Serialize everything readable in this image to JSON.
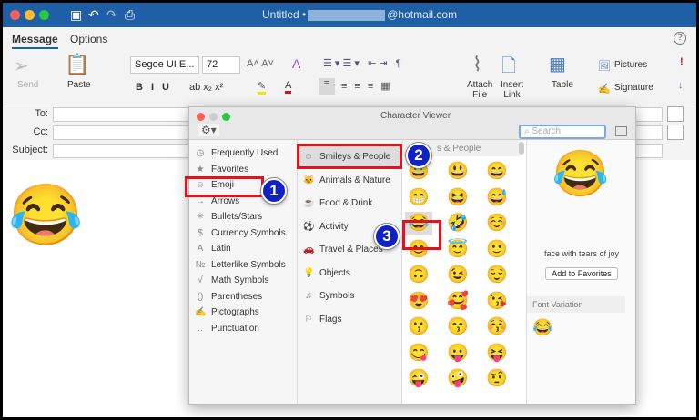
{
  "window": {
    "title_prefix": "Untitled •",
    "title_suffix": "@hotmail.com"
  },
  "tabs": [
    {
      "label": "Message",
      "active": true
    },
    {
      "label": "Options",
      "active": false
    }
  ],
  "ribbon": {
    "send": "Send",
    "paste": "Paste",
    "font": "Segoe UI E...",
    "size": "72",
    "attach": "Attach\nFile",
    "attach1": "Attach",
    "attach2": "File",
    "link1": "Insert",
    "link2": "Link",
    "table": "Table",
    "pictures": "Pictures",
    "signature": "Signature"
  },
  "fields": {
    "to": "To:",
    "cc": "Cc:",
    "subject": "Subject:"
  },
  "body_emoji": "😂",
  "char_viewer": {
    "title": "Character Viewer",
    "search_placeholder": "Search",
    "categories": [
      {
        "label": "Frequently Used",
        "icon": "◷"
      },
      {
        "label": "Favorites",
        "icon": "★"
      },
      {
        "label": "Emoji",
        "icon": "☺"
      },
      {
        "label": "Arrows",
        "icon": "→"
      },
      {
        "label": "Bullets/Stars",
        "icon": "✳"
      },
      {
        "label": "Currency Symbols",
        "icon": "$"
      },
      {
        "label": "Latin",
        "icon": "A"
      },
      {
        "label": "Letterlike Symbols",
        "icon": "№"
      },
      {
        "label": "Math Symbols",
        "icon": "√"
      },
      {
        "label": "Parentheses",
        "icon": "()"
      },
      {
        "label": "Pictographs",
        "icon": "✍"
      },
      {
        "label": "Punctuation",
        "icon": "‥"
      }
    ],
    "subcategories": [
      {
        "label": "Smileys & People",
        "icon": "☺"
      },
      {
        "label": "Animals & Nature",
        "icon": "🐱"
      },
      {
        "label": "Food & Drink",
        "icon": "☕"
      },
      {
        "label": "Activity",
        "icon": "⚽"
      },
      {
        "label": "Travel & Places",
        "icon": "🚗"
      },
      {
        "label": "Objects",
        "icon": "💡"
      },
      {
        "label": "Symbols",
        "icon": "♫"
      },
      {
        "label": "Flags",
        "icon": "⚐"
      }
    ],
    "grid_header": "s & People",
    "emojis": [
      "😀",
      "😃",
      "😄",
      "😁",
      "😆",
      "😅",
      "😂",
      "🤣",
      "☺️",
      "😊",
      "😇",
      "🙂",
      "🙃",
      "😉",
      "😌",
      "😍",
      "🥰",
      "😘",
      "😗",
      "😙",
      "😚",
      "😋",
      "😛",
      "😝",
      "😜",
      "🤪",
      "🤨"
    ],
    "selected_emoji": "😂",
    "selected_name": "face with tears of joy",
    "add_favorites": "Add to Favorites",
    "font_variation": "Font Variation"
  },
  "steps": [
    "1",
    "2",
    "3"
  ],
  "colors": {
    "titlebar": "#1f5fa6",
    "highlight": "#e0141e",
    "badge": "#1022c4"
  }
}
